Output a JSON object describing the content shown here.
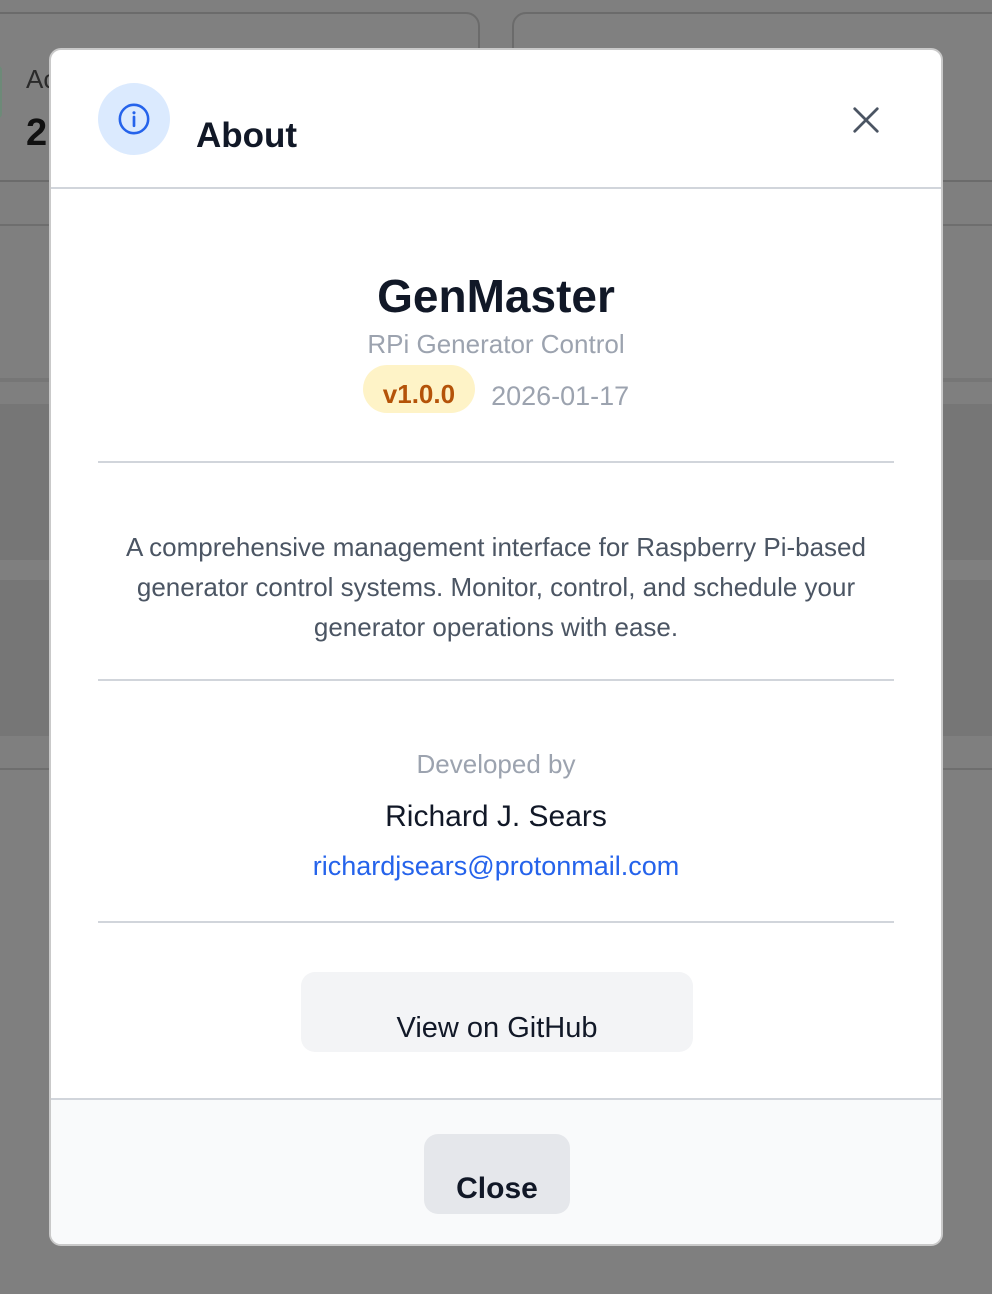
{
  "background": {
    "stat_label": "Ac",
    "stat_value": "2"
  },
  "modal": {
    "title": "About",
    "info_icon": "info-icon",
    "close_icon": "close-icon"
  },
  "app": {
    "name": "GenMaster",
    "subtitle": "RPi Generator Control",
    "version": "v1.0.0",
    "release_date": "2026-01-17",
    "description": "A comprehensive management interface for Raspberry Pi-based generator control systems. Monitor, control, and schedule your generator operations with ease."
  },
  "developer": {
    "label": "Developed by",
    "name": "Richard J. Sears",
    "email": "richardjsears@protonmail.com"
  },
  "buttons": {
    "github": "View on GitHub",
    "close": "Close"
  },
  "colors": {
    "accent_blue": "#2563eb",
    "version_badge_bg": "#fef3c7",
    "version_badge_text": "#b45309",
    "overlay": "#7f7f7f"
  }
}
